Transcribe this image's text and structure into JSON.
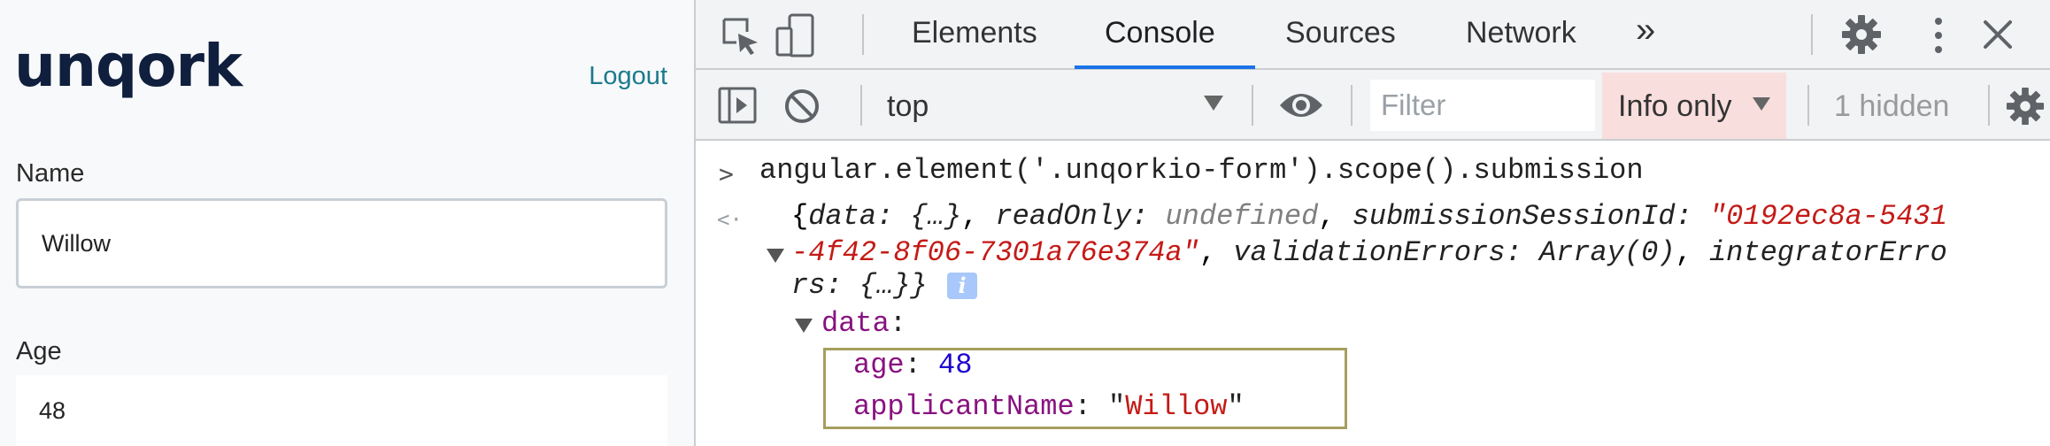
{
  "app": {
    "logo_text": "unqork",
    "logout_label": "Logout",
    "fields": [
      {
        "label": "Name",
        "value": "Willow"
      },
      {
        "label": "Age",
        "value": "48"
      }
    ]
  },
  "devtools": {
    "tabs": [
      "Elements",
      "Console",
      "Sources",
      "Network"
    ],
    "active_tab": "Console",
    "more_tabs_glyph": "»",
    "context": "top",
    "filter_placeholder": "Filter",
    "log_levels": "Info only",
    "hidden_count": "1 hidden",
    "icons": [
      "inspect-icon",
      "device-toolbar-icon",
      "settings-icon",
      "kebab-menu-icon",
      "close-icon",
      "sidebar-toggle-icon",
      "clear-console-icon",
      "live-expression-eye-icon",
      "console-settings-icon",
      "info-icon"
    ],
    "accent_color": "#1a73e8"
  },
  "console": {
    "command": "angular.element('.unqorkio-form').scope().submission",
    "result": {
      "data_key": "data",
      "data_preview": "{…}",
      "readOnly_key": "readOnly",
      "readOnly_value": "undefined",
      "sessionId_key": "submissionSessionId",
      "sessionId_part1": "\"0192ec8a-5431",
      "sessionId_part2": "-4f42-8f06-7301a76e374a\"",
      "validationErrors_key": "validationErrors",
      "validationErrors_value": "Array(0)",
      "integrator_part1": "integratorErro",
      "integrator_part2": "rs",
      "integrator_value": "{…}",
      "info_glyph": "i"
    },
    "expanded": {
      "label": "data",
      "entries": [
        {
          "key": "age",
          "value": "48",
          "type": "number"
        },
        {
          "key": "applicantName",
          "value": "Willow",
          "type": "string"
        }
      ]
    }
  }
}
